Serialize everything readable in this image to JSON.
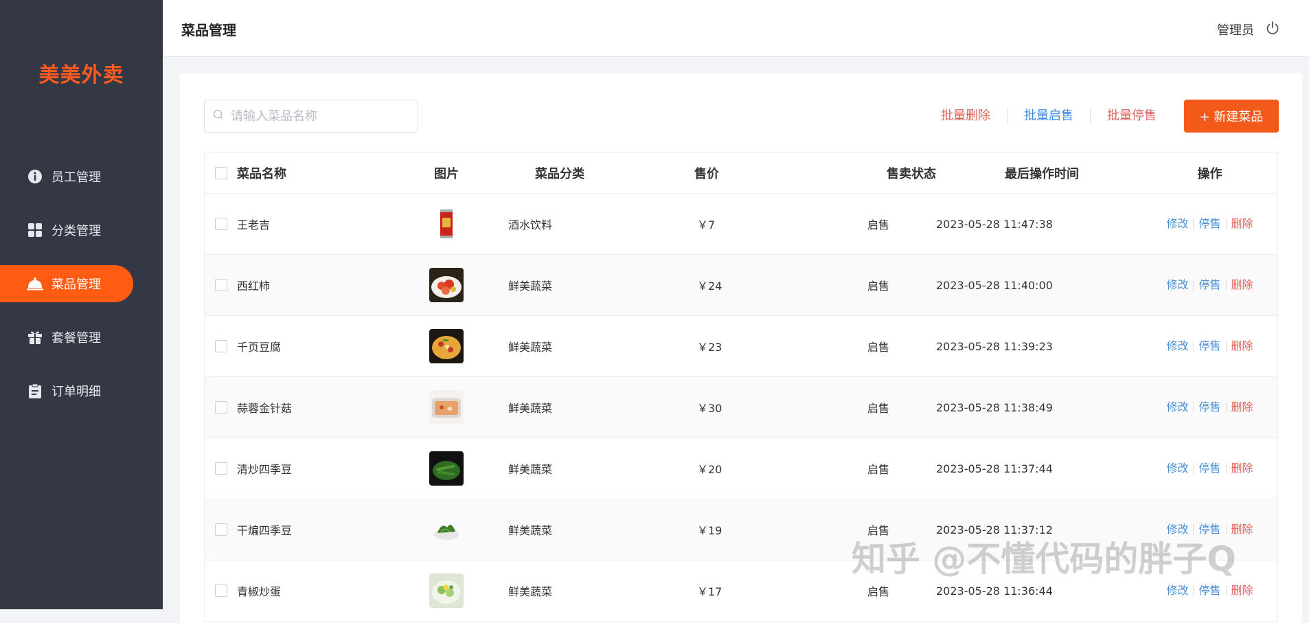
{
  "app": {
    "logo": "美美外卖"
  },
  "sidebar": {
    "items": [
      {
        "label": "员工管理",
        "icon": "user-info-icon",
        "active": false
      },
      {
        "label": "分类管理",
        "icon": "grid-icon",
        "active": false
      },
      {
        "label": "菜品管理",
        "icon": "dish-cover-icon",
        "active": true
      },
      {
        "label": "套餐管理",
        "icon": "gift-icon",
        "active": false
      },
      {
        "label": "订单明细",
        "icon": "clipboard-icon",
        "active": false
      }
    ]
  },
  "header": {
    "title": "菜品管理",
    "user": "管理员",
    "logout_icon": "power-icon"
  },
  "toolbar": {
    "search_placeholder": "请输入菜品名称",
    "batch_delete": "批量删除",
    "batch_enable": "批量启售",
    "batch_disable": "批量停售",
    "new_dish": "+ 新建菜品"
  },
  "colors": {
    "accent": "#ff5b13",
    "sidebar": "#343744",
    "link": "#4b91d6",
    "danger": "#e0645e"
  },
  "table": {
    "columns": [
      "菜品名称",
      "图片",
      "菜品分类",
      "售价",
      "售卖状态",
      "最后操作时间",
      "操作"
    ],
    "actions": {
      "edit": "修改",
      "stop": "停售",
      "delete": "删除"
    },
    "rows": [
      {
        "name": "王老吉",
        "category": "酒水饮料",
        "price": "￥7",
        "status": "启售",
        "time": "2023-05-28 11:47:38"
      },
      {
        "name": "西红柿",
        "category": "鲜美蔬菜",
        "price": "￥24",
        "status": "启售",
        "time": "2023-05-28 11:40:00"
      },
      {
        "name": "千页豆腐",
        "category": "鲜美蔬菜",
        "price": "￥23",
        "status": "启售",
        "time": "2023-05-28 11:39:23"
      },
      {
        "name": "蒜蓉金针菇",
        "category": "鲜美蔬菜",
        "price": "￥30",
        "status": "启售",
        "time": "2023-05-28 11:38:49"
      },
      {
        "name": "清炒四季豆",
        "category": "鲜美蔬菜",
        "price": "￥20",
        "status": "启售",
        "time": "2023-05-28 11:37:44"
      },
      {
        "name": "干煸四季豆",
        "category": "鲜美蔬菜",
        "price": "￥19",
        "status": "启售",
        "time": "2023-05-28 11:37:12"
      },
      {
        "name": "青椒炒蛋",
        "category": "鲜美蔬菜",
        "price": "￥17",
        "status": "启售",
        "time": "2023-05-28 11:36:44"
      }
    ]
  },
  "watermark": "知乎 @不懂代码的胖子Q"
}
